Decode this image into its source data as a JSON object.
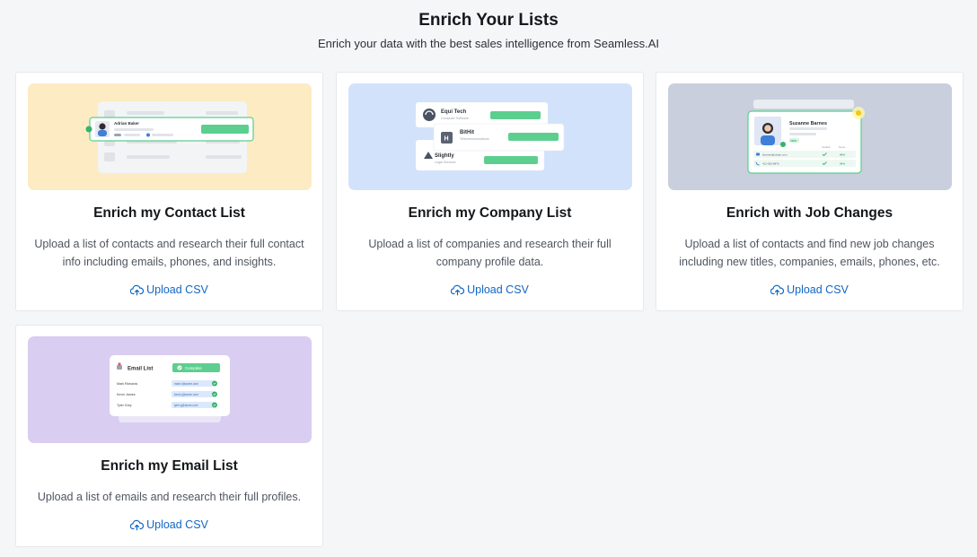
{
  "header": {
    "title": "Enrich Your Lists",
    "subtitle": "Enrich your data with the best sales intelligence from Seamless.AI"
  },
  "colors": {
    "accent": "#1266c4",
    "contact_bg": "#fdebc4",
    "company_bg": "#d3e2fb",
    "jobs_bg": "#c9cfdd",
    "email_bg": "#d9cdf1",
    "success_green": "#5ccf8f"
  },
  "cards": [
    {
      "title": "Enrich my Contact List",
      "description": "Upload a list of contacts and research their full contact info including emails, phones, and insights.",
      "action_label": "Upload CSV",
      "action_icon": "cloud-upload-icon",
      "illustration": {
        "name": "Adrian Baker"
      }
    },
    {
      "title": "Enrich my Company List",
      "description": "Upload a list of companies and research their full company profile data.",
      "action_label": "Upload CSV",
      "action_icon": "cloud-upload-icon",
      "illustration": {
        "companies": [
          {
            "name": "Equi Tech",
            "sub": "Computer Software"
          },
          {
            "name": "BitHit",
            "sub": "Telecommunications"
          },
          {
            "name": "Slightly",
            "sub": "Legal Services"
          }
        ]
      }
    },
    {
      "title": "Enrich with Job Changes",
      "description": "Upload a list of contacts and find new job changes including new titles, companies, emails, phones, etc.",
      "action_label": "Upload CSV",
      "action_icon": "cloud-upload-icon",
      "illustration": {
        "name": "Suzanne Barnes",
        "badge": "NEW",
        "col1": "Verified",
        "col2": "Score",
        "email": "sbarnes@origin.com",
        "phone": "412-555-8875",
        "score1": "98%",
        "score2": "94%"
      }
    },
    {
      "title": "Enrich my Email List",
      "description": "Upload a list of emails and research their full profiles.",
      "action_label": "Upload CSV",
      "action_icon": "cloud-upload-icon",
      "illustration": {
        "title": "Email List",
        "status": "Complete",
        "rows": [
          {
            "name": "Mark Richards",
            "email": "mark.r@acme.com"
          },
          {
            "name": "Kevin James",
            "email": "kevin.j@acme.com"
          },
          {
            "name": "Tyler Grey",
            "email": "tyler.g@acme.com"
          }
        ]
      }
    }
  ]
}
